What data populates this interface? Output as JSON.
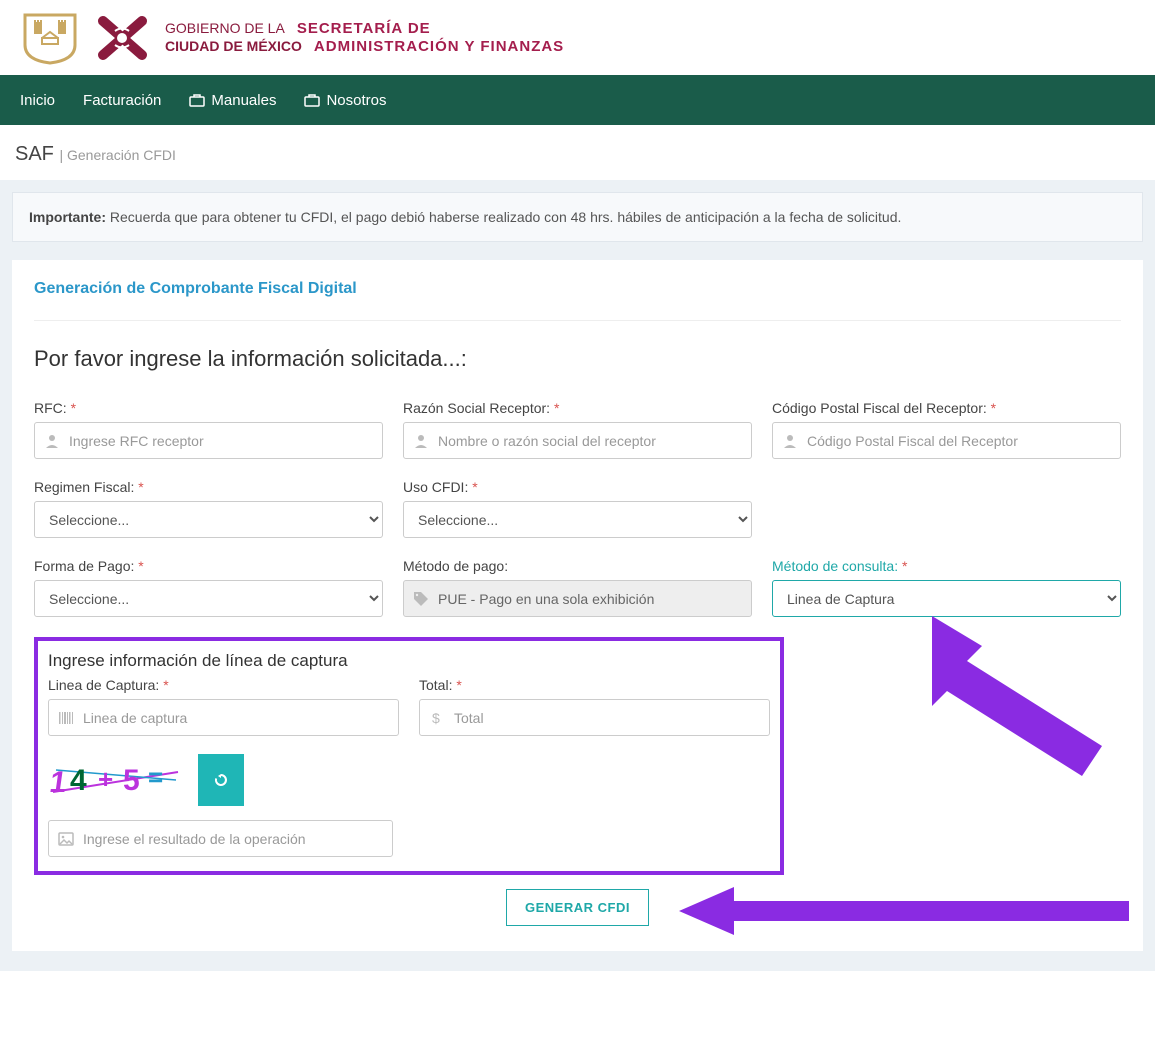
{
  "header": {
    "gov_line1_a": "GOBIERNO DE LA",
    "gov_line1_b": "SECRETARÍA DE",
    "gov_line2_a": "CIUDAD DE MÉXICO",
    "gov_line2_b": "ADMINISTRACIÓN Y FINANZAS"
  },
  "nav": {
    "inicio": "Inicio",
    "facturacion": "Facturación",
    "manuales": "Manuales",
    "nosotros": "Nosotros"
  },
  "breadcrumb": {
    "main": "SAF",
    "sub": "| Generación CFDI"
  },
  "alert": {
    "label": "Importante:",
    "text": " Recuerda que para obtener tu CFDI, el pago debió haberse realizado con 48 hrs. hábiles de anticipación a la fecha de solicitud."
  },
  "panel": {
    "title": "Generación de Comprobante Fiscal Digital",
    "subtitle": "Por favor ingrese la información solicitada...:"
  },
  "form": {
    "rfc": {
      "label": "RFC: ",
      "placeholder": "Ingrese RFC receptor"
    },
    "razon": {
      "label": "Razón Social Receptor: ",
      "placeholder": "Nombre o razón social del receptor"
    },
    "cp": {
      "label": "Código Postal Fiscal del Receptor: ",
      "placeholder": "Código Postal Fiscal del Receptor"
    },
    "regimen": {
      "label": "Regimen Fiscal: ",
      "option": "Seleccione..."
    },
    "uso": {
      "label": "Uso CFDI: ",
      "option": "Seleccione..."
    },
    "forma": {
      "label": "Forma de Pago: ",
      "option": "Seleccione..."
    },
    "metodo_pago": {
      "label": "Método de pago:",
      "value": "PUE - Pago en una sola exhibición"
    },
    "metodo_consulta": {
      "label": "Método de consulta: ",
      "option": "Linea de Captura"
    }
  },
  "capture": {
    "title": "Ingrese información de línea de captura",
    "linea": {
      "label": "Linea de Captura: ",
      "placeholder": "Linea de captura"
    },
    "total": {
      "label": "Total: ",
      "placeholder": "Total"
    },
    "captcha_text": "14 + 5 =",
    "captcha_placeholder": "Ingrese el resultado de la operación"
  },
  "buttons": {
    "generate": "GENERAR CFDI"
  }
}
